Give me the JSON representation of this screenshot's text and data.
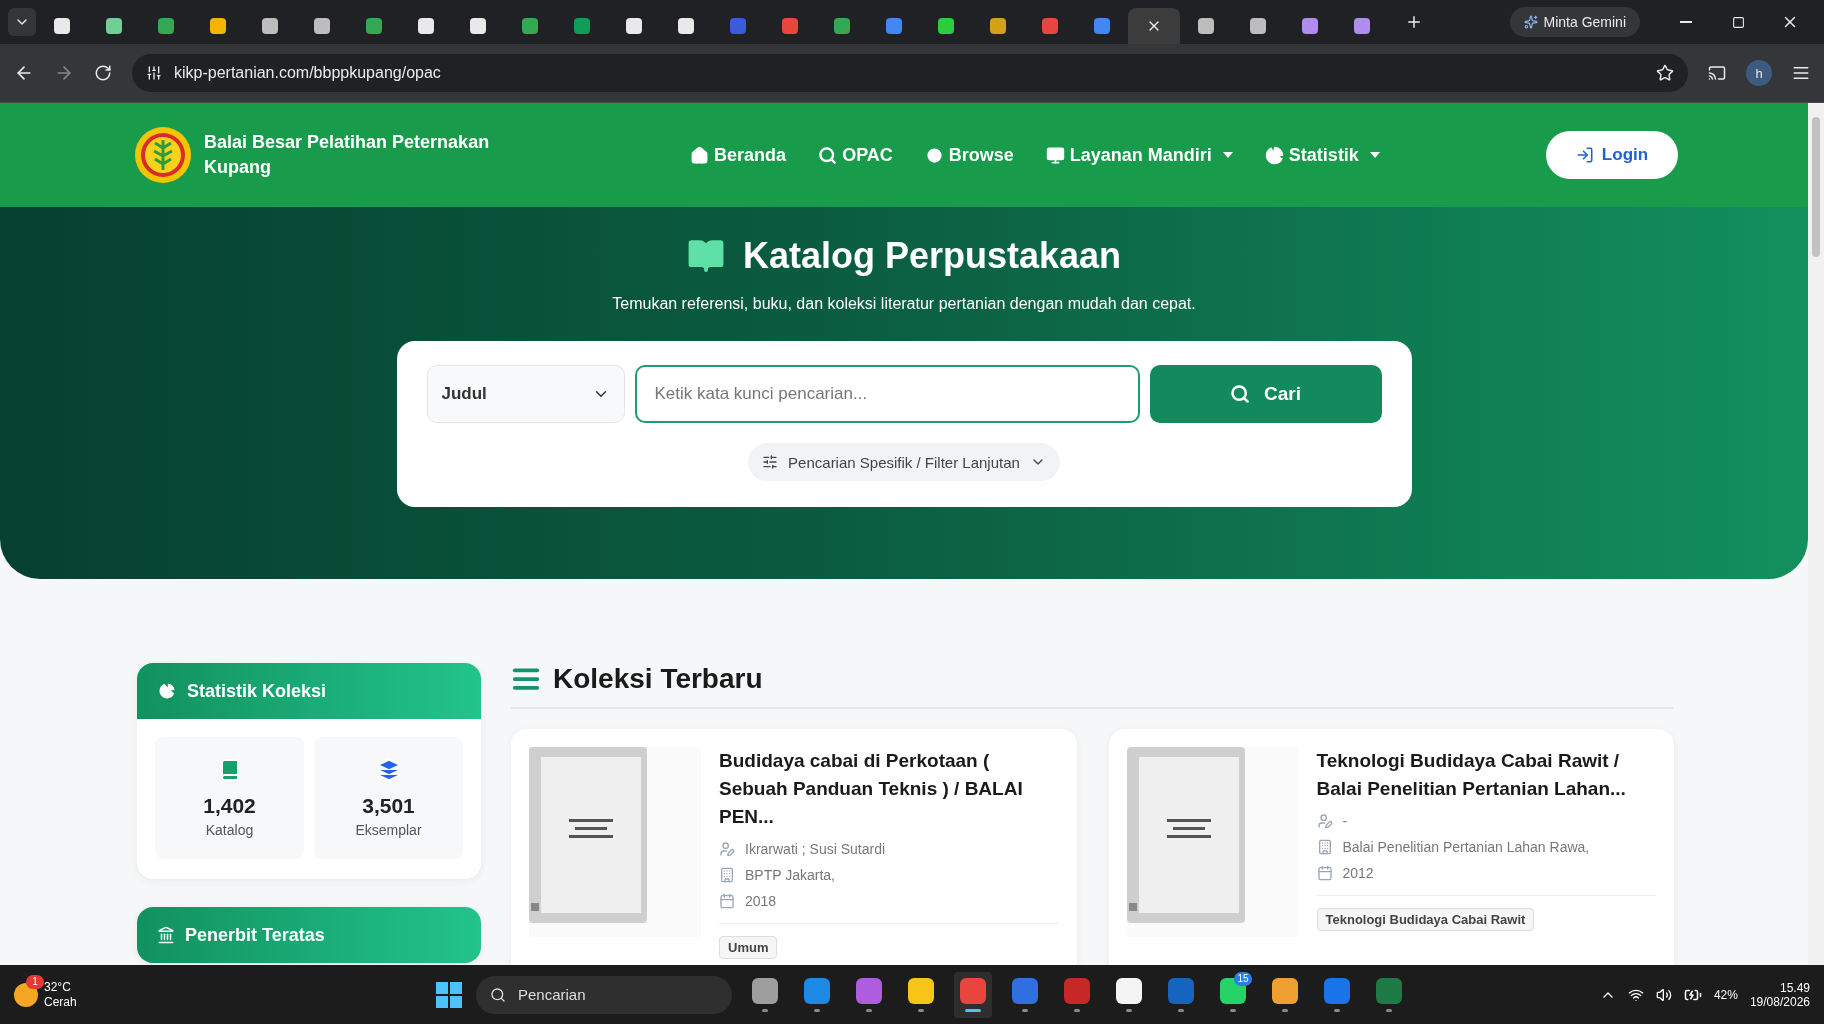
{
  "browser": {
    "tabs": [
      {
        "selected": false
      },
      {
        "selected": false
      },
      {
        "selected": false
      },
      {
        "selected": false
      },
      {
        "selected": false
      },
      {
        "selected": false
      },
      {
        "selected": false
      },
      {
        "selected": false
      },
      {
        "selected": false
      },
      {
        "selected": false
      },
      {
        "selected": false
      },
      {
        "selected": false
      },
      {
        "selected": false
      },
      {
        "selected": false
      },
      {
        "selected": false
      },
      {
        "selected": false
      },
      {
        "selected": false
      },
      {
        "selected": false
      },
      {
        "selected": false
      },
      {
        "selected": false
      },
      {
        "selected": false
      },
      {
        "selected": true
      },
      {
        "selected": false
      },
      {
        "selected": false
      },
      {
        "selected": false
      },
      {
        "selected": false
      }
    ],
    "gemini_button": "Minta Gemini",
    "url": "kikp-pertanian.com/bbppkupang/opac",
    "profile": "h"
  },
  "site_header": {
    "brand": "Balai Besar Pelatihan Peternakan Kupang",
    "nav": [
      {
        "label": "Beranda",
        "dropdown": false
      },
      {
        "label": "OPAC",
        "dropdown": false
      },
      {
        "label": "Browse",
        "dropdown": false
      },
      {
        "label": "Layanan Mandiri",
        "dropdown": true
      },
      {
        "label": "Statistik",
        "dropdown": true
      }
    ],
    "login": "Login"
  },
  "hero": {
    "title": "Katalog Perpustakaan",
    "subtitle": "Temukan referensi, buku, dan koleksi literatur pertanian dengan mudah dan cepat.",
    "search": {
      "field_select": "Judul",
      "placeholder": "Ketik kata kunci pencarian...",
      "button": "Cari",
      "advanced": "Pencarian Spesifik / Filter Lanjutan"
    }
  },
  "sidebar": {
    "stats_card": {
      "title": "Statistik Koleksi",
      "stats": [
        {
          "value": "1,402",
          "label": "Katalog"
        },
        {
          "value": "3,501",
          "label": "Eksemplar"
        }
      ]
    },
    "publishers_card": {
      "title": "Penerbit Teratas"
    }
  },
  "collection": {
    "heading": "Koleksi Terbaru",
    "books": [
      {
        "title": "Budidaya cabai di Perkotaan ( Sebuah Panduan Teknis ) / BALAI PEN...",
        "author": "Ikrarwati ; Susi Sutardi",
        "publisher": "BPTP Jakarta,",
        "year": "2018",
        "tag": "Umum"
      },
      {
        "title": "Teknologi Budidaya Cabai Rawit / Balai Penelitian Pertanian Lahan...",
        "author": "-",
        "publisher": "Balai Penelitian Pertanian Lahan Rawa,",
        "year": "2012",
        "tag": "Teknologi Budidaya Cabai Rawit"
      }
    ]
  },
  "taskbar": {
    "weather": {
      "temperature": "32°C",
      "condition": "Cerah",
      "badge": "1"
    },
    "search": "Pencarian",
    "apps": [
      {
        "active": false
      },
      {
        "active": false
      },
      {
        "active": false
      },
      {
        "active": false
      },
      {
        "active": true
      },
      {
        "active": false
      },
      {
        "active": false
      },
      {
        "active": false
      },
      {
        "active": false
      },
      {
        "active": false,
        "badge": "15"
      },
      {
        "active": false
      },
      {
        "active": false
      },
      {
        "active": false
      }
    ],
    "battery": "42%",
    "time": "15.49",
    "date": "19/08/2026"
  }
}
